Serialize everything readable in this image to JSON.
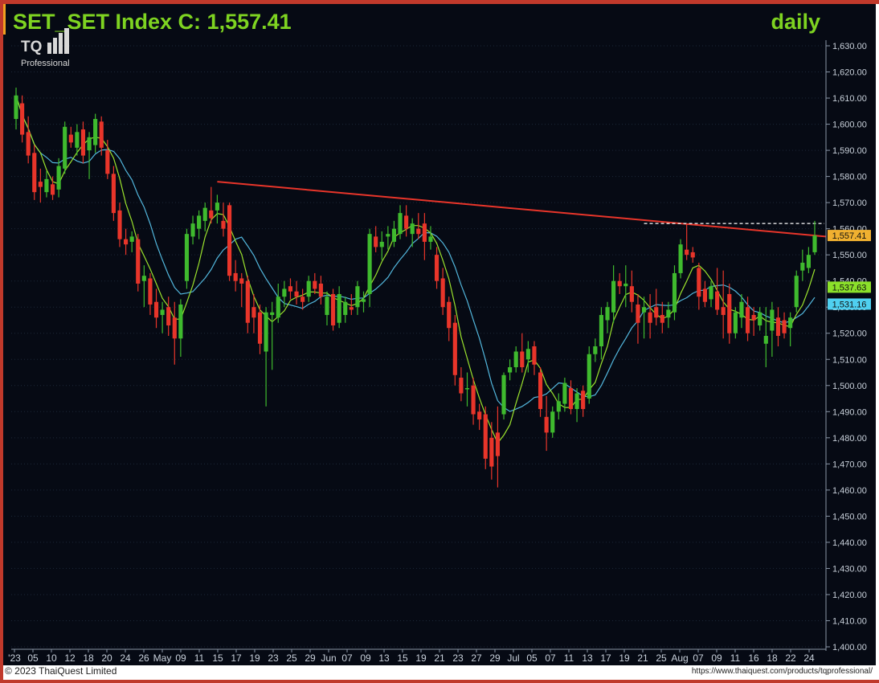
{
  "header": {
    "title": "SET_SET Index C: 1,557.41",
    "timeframe": "daily",
    "logo_text": "TQ",
    "logo_sub": "Professional"
  },
  "footer": {
    "copyright": "© 2023 ThaiQuest Limited",
    "url": "https://www.thaiquest.com/products/tqprofessional/"
  },
  "colors": {
    "background": "#060a14",
    "up": "#3fba2e",
    "down": "#e8352a",
    "ma_short": "#9be22d",
    "ma_long": "#52b6dc",
    "trendline": "#e8352a",
    "title": "#7ed321",
    "grid": "#1c2838"
  },
  "chart_data": {
    "type": "candlestick",
    "y_axis": {
      "min": 1400,
      "max": 1630,
      "ticks": [
        "1,630.00",
        "1,620.00",
        "1,610.00",
        "1,600.00",
        "1,590.00",
        "1,580.00",
        "1,570.00",
        "1,560.00",
        "1,550.00",
        "1,540.00",
        "1,530.00",
        "1,520.00",
        "1,510.00",
        "1,500.00",
        "1,490.00",
        "1,480.00",
        "1,470.00",
        "1,460.00",
        "1,450.00",
        "1,440.00",
        "1,430.00",
        "1,420.00",
        "1,410.00",
        "1,400.00"
      ]
    },
    "x_tick_labels": [
      "'23",
      "05",
      "10",
      "12",
      "18",
      "20",
      "24",
      "26",
      "May",
      "09",
      "11",
      "15",
      "17",
      "19",
      "23",
      "25",
      "29",
      "Jun",
      "07",
      "09",
      "13",
      "15",
      "19",
      "21",
      "23",
      "27",
      "29",
      "Jul",
      "05",
      "07",
      "11",
      "13",
      "17",
      "19",
      "21",
      "25",
      "Aug",
      "07",
      "09",
      "11",
      "16",
      "18",
      "22",
      "24"
    ],
    "price_labels": [
      {
        "text": "1,557.41",
        "value": 1557.41,
        "color": "#f0b030"
      },
      {
        "text": "1,537.63",
        "value": 1537.63,
        "color": "#8be02a"
      },
      {
        "text": "1,531.16",
        "value": 1531.16,
        "color": "#4fd0f0"
      }
    ],
    "resistance_level": 1562,
    "trendline": {
      "from": {
        "index": 33,
        "value": 1578
      },
      "to": {
        "index": 143,
        "value": 1557
      }
    },
    "candles": [
      {
        "o": 1602,
        "h": 1614,
        "l": 1598,
        "c": 1611
      },
      {
        "o": 1608,
        "h": 1611,
        "l": 1593,
        "c": 1596
      },
      {
        "o": 1597,
        "h": 1603,
        "l": 1585,
        "c": 1588
      },
      {
        "o": 1589,
        "h": 1592,
        "l": 1571,
        "c": 1574
      },
      {
        "o": 1578,
        "h": 1583,
        "l": 1570,
        "c": 1576
      },
      {
        "o": 1574,
        "h": 1582,
        "l": 1572,
        "c": 1579
      },
      {
        "o": 1577,
        "h": 1580,
        "l": 1571,
        "c": 1573
      },
      {
        "o": 1575,
        "h": 1587,
        "l": 1572,
        "c": 1584
      },
      {
        "o": 1583,
        "h": 1601,
        "l": 1581,
        "c": 1599
      },
      {
        "o": 1596,
        "h": 1599,
        "l": 1591,
        "c": 1593
      },
      {
        "o": 1591,
        "h": 1600,
        "l": 1588,
        "c": 1597
      },
      {
        "o": 1598,
        "h": 1601,
        "l": 1585,
        "c": 1588
      },
      {
        "o": 1590,
        "h": 1597,
        "l": 1579,
        "c": 1595
      },
      {
        "o": 1592,
        "h": 1604,
        "l": 1589,
        "c": 1602
      },
      {
        "o": 1601,
        "h": 1603,
        "l": 1588,
        "c": 1591
      },
      {
        "o": 1590,
        "h": 1594,
        "l": 1579,
        "c": 1581
      },
      {
        "o": 1581,
        "h": 1584,
        "l": 1563,
        "c": 1566
      },
      {
        "o": 1567,
        "h": 1570,
        "l": 1553,
        "c": 1556
      },
      {
        "o": 1556,
        "h": 1560,
        "l": 1550,
        "c": 1554
      },
      {
        "o": 1555,
        "h": 1559,
        "l": 1551,
        "c": 1557
      },
      {
        "o": 1556,
        "h": 1558,
        "l": 1536,
        "c": 1539
      },
      {
        "o": 1540,
        "h": 1546,
        "l": 1530,
        "c": 1542
      },
      {
        "o": 1541,
        "h": 1543,
        "l": 1527,
        "c": 1531
      },
      {
        "o": 1532,
        "h": 1537,
        "l": 1522,
        "c": 1526
      },
      {
        "o": 1527,
        "h": 1532,
        "l": 1520,
        "c": 1529
      },
      {
        "o": 1530,
        "h": 1534,
        "l": 1519,
        "c": 1523
      },
      {
        "o": 1526,
        "h": 1532,
        "l": 1508,
        "c": 1518
      },
      {
        "o": 1518,
        "h": 1533,
        "l": 1511,
        "c": 1531
      },
      {
        "o": 1540,
        "h": 1560,
        "l": 1537,
        "c": 1558
      },
      {
        "o": 1557,
        "h": 1565,
        "l": 1554,
        "c": 1562
      },
      {
        "o": 1560,
        "h": 1567,
        "l": 1556,
        "c": 1565
      },
      {
        "o": 1563,
        "h": 1570,
        "l": 1559,
        "c": 1568
      },
      {
        "o": 1567,
        "h": 1576,
        "l": 1562,
        "c": 1564
      },
      {
        "o": 1567,
        "h": 1573,
        "l": 1562,
        "c": 1570
      },
      {
        "o": 1563,
        "h": 1570,
        "l": 1557,
        "c": 1560
      },
      {
        "o": 1569,
        "h": 1570,
        "l": 1540,
        "c": 1542
      },
      {
        "o": 1543,
        "h": 1548,
        "l": 1536,
        "c": 1540
      },
      {
        "o": 1541,
        "h": 1543,
        "l": 1530,
        "c": 1539
      },
      {
        "o": 1540,
        "h": 1542,
        "l": 1520,
        "c": 1524
      },
      {
        "o": 1530,
        "h": 1535,
        "l": 1520,
        "c": 1526
      },
      {
        "o": 1528,
        "h": 1531,
        "l": 1512,
        "c": 1516
      },
      {
        "o": 1513,
        "h": 1530,
        "l": 1492,
        "c": 1528
      },
      {
        "o": 1527,
        "h": 1532,
        "l": 1506,
        "c": 1528
      },
      {
        "o": 1526,
        "h": 1539,
        "l": 1524,
        "c": 1534
      },
      {
        "o": 1534,
        "h": 1540,
        "l": 1530,
        "c": 1537
      },
      {
        "o": 1538,
        "h": 1541,
        "l": 1533,
        "c": 1536
      },
      {
        "o": 1536,
        "h": 1540,
        "l": 1531,
        "c": 1534
      },
      {
        "o": 1534,
        "h": 1537,
        "l": 1529,
        "c": 1532
      },
      {
        "o": 1534,
        "h": 1542,
        "l": 1532,
        "c": 1540
      },
      {
        "o": 1540,
        "h": 1543,
        "l": 1535,
        "c": 1537
      },
      {
        "o": 1539,
        "h": 1542,
        "l": 1531,
        "c": 1534
      },
      {
        "o": 1527,
        "h": 1536,
        "l": 1523,
        "c": 1534
      },
      {
        "o": 1535,
        "h": 1537,
        "l": 1521,
        "c": 1523
      },
      {
        "o": 1524,
        "h": 1538,
        "l": 1522,
        "c": 1535
      },
      {
        "o": 1527,
        "h": 1534,
        "l": 1524,
        "c": 1532
      },
      {
        "o": 1530,
        "h": 1535,
        "l": 1527,
        "c": 1529
      },
      {
        "o": 1530,
        "h": 1540,
        "l": 1527,
        "c": 1538
      },
      {
        "o": 1532,
        "h": 1536,
        "l": 1528,
        "c": 1533
      },
      {
        "o": 1535,
        "h": 1560,
        "l": 1530,
        "c": 1558
      },
      {
        "o": 1557,
        "h": 1561,
        "l": 1551,
        "c": 1553
      },
      {
        "o": 1553,
        "h": 1559,
        "l": 1548,
        "c": 1555
      },
      {
        "o": 1557,
        "h": 1561,
        "l": 1552,
        "c": 1558
      },
      {
        "o": 1555,
        "h": 1563,
        "l": 1553,
        "c": 1560
      },
      {
        "o": 1558,
        "h": 1569,
        "l": 1556,
        "c": 1566
      },
      {
        "o": 1565,
        "h": 1569,
        "l": 1557,
        "c": 1560
      },
      {
        "o": 1558,
        "h": 1564,
        "l": 1553,
        "c": 1562
      },
      {
        "o": 1560,
        "h": 1566,
        "l": 1556,
        "c": 1558
      },
      {
        "o": 1562,
        "h": 1566,
        "l": 1548,
        "c": 1555
      },
      {
        "o": 1555,
        "h": 1561,
        "l": 1552,
        "c": 1557
      },
      {
        "o": 1550,
        "h": 1553,
        "l": 1537,
        "c": 1540
      },
      {
        "o": 1541,
        "h": 1545,
        "l": 1527,
        "c": 1530
      },
      {
        "o": 1532,
        "h": 1534,
        "l": 1517,
        "c": 1522
      },
      {
        "o": 1524,
        "h": 1527,
        "l": 1500,
        "c": 1504
      },
      {
        "o": 1503,
        "h": 1507,
        "l": 1494,
        "c": 1497
      },
      {
        "o": 1499,
        "h": 1505,
        "l": 1492,
        "c": 1499
      },
      {
        "o": 1500,
        "h": 1503,
        "l": 1485,
        "c": 1489
      },
      {
        "o": 1490,
        "h": 1493,
        "l": 1483,
        "c": 1487
      },
      {
        "o": 1489,
        "h": 1492,
        "l": 1468,
        "c": 1472
      },
      {
        "o": 1480,
        "h": 1486,
        "l": 1464,
        "c": 1469
      },
      {
        "o": 1482,
        "h": 1492,
        "l": 1461,
        "c": 1473
      },
      {
        "o": 1489,
        "h": 1505,
        "l": 1487,
        "c": 1504
      },
      {
        "o": 1505,
        "h": 1510,
        "l": 1502,
        "c": 1507
      },
      {
        "o": 1507,
        "h": 1515,
        "l": 1505,
        "c": 1513
      },
      {
        "o": 1513,
        "h": 1520,
        "l": 1505,
        "c": 1507
      },
      {
        "o": 1510,
        "h": 1517,
        "l": 1505,
        "c": 1514
      },
      {
        "o": 1515,
        "h": 1517,
        "l": 1504,
        "c": 1508
      },
      {
        "o": 1505,
        "h": 1507,
        "l": 1488,
        "c": 1491
      },
      {
        "o": 1488,
        "h": 1496,
        "l": 1475,
        "c": 1482
      },
      {
        "o": 1482,
        "h": 1492,
        "l": 1480,
        "c": 1490
      },
      {
        "o": 1490,
        "h": 1497,
        "l": 1487,
        "c": 1494
      },
      {
        "o": 1493,
        "h": 1503,
        "l": 1490,
        "c": 1501
      },
      {
        "o": 1499,
        "h": 1502,
        "l": 1489,
        "c": 1491
      },
      {
        "o": 1491,
        "h": 1499,
        "l": 1486,
        "c": 1497
      },
      {
        "o": 1498,
        "h": 1500,
        "l": 1488,
        "c": 1491
      },
      {
        "o": 1495,
        "h": 1515,
        "l": 1493,
        "c": 1512
      },
      {
        "o": 1512,
        "h": 1518,
        "l": 1509,
        "c": 1515
      },
      {
        "o": 1515,
        "h": 1530,
        "l": 1510,
        "c": 1527
      },
      {
        "o": 1525,
        "h": 1532,
        "l": 1520,
        "c": 1530
      },
      {
        "o": 1528,
        "h": 1546,
        "l": 1524,
        "c": 1540
      },
      {
        "o": 1540,
        "h": 1543,
        "l": 1535,
        "c": 1538
      },
      {
        "o": 1538,
        "h": 1546,
        "l": 1530,
        "c": 1539
      },
      {
        "o": 1538,
        "h": 1544,
        "l": 1528,
        "c": 1532
      },
      {
        "o": 1531,
        "h": 1535,
        "l": 1516,
        "c": 1524
      },
      {
        "o": 1528,
        "h": 1534,
        "l": 1518,
        "c": 1530
      },
      {
        "o": 1528,
        "h": 1535,
        "l": 1518,
        "c": 1524
      },
      {
        "o": 1530,
        "h": 1537,
        "l": 1523,
        "c": 1526
      },
      {
        "o": 1527,
        "h": 1532,
        "l": 1520,
        "c": 1524
      },
      {
        "o": 1526,
        "h": 1532,
        "l": 1522,
        "c": 1529
      },
      {
        "o": 1528,
        "h": 1546,
        "l": 1525,
        "c": 1543
      },
      {
        "o": 1543,
        "h": 1556,
        "l": 1541,
        "c": 1554
      },
      {
        "o": 1552,
        "h": 1562,
        "l": 1548,
        "c": 1550
      },
      {
        "o": 1551,
        "h": 1553,
        "l": 1547,
        "c": 1549
      },
      {
        "o": 1545,
        "h": 1547,
        "l": 1529,
        "c": 1534
      },
      {
        "o": 1537,
        "h": 1540,
        "l": 1530,
        "c": 1532
      },
      {
        "o": 1533,
        "h": 1540,
        "l": 1530,
        "c": 1538
      },
      {
        "o": 1536,
        "h": 1545,
        "l": 1527,
        "c": 1529
      },
      {
        "o": 1530,
        "h": 1544,
        "l": 1518,
        "c": 1527
      },
      {
        "o": 1535,
        "h": 1539,
        "l": 1516,
        "c": 1520
      },
      {
        "o": 1520,
        "h": 1530,
        "l": 1518,
        "c": 1528
      },
      {
        "o": 1526,
        "h": 1535,
        "l": 1522,
        "c": 1532
      },
      {
        "o": 1530,
        "h": 1534,
        "l": 1517,
        "c": 1520
      },
      {
        "o": 1527,
        "h": 1530,
        "l": 1519,
        "c": 1525
      },
      {
        "o": 1523,
        "h": 1530,
        "l": 1521,
        "c": 1528
      },
      {
        "o": 1516,
        "h": 1530,
        "l": 1507,
        "c": 1519
      },
      {
        "o": 1521,
        "h": 1532,
        "l": 1511,
        "c": 1529
      },
      {
        "o": 1526,
        "h": 1530,
        "l": 1515,
        "c": 1519
      },
      {
        "o": 1525,
        "h": 1528,
        "l": 1518,
        "c": 1520
      },
      {
        "o": 1522,
        "h": 1528,
        "l": 1515,
        "c": 1526
      },
      {
        "o": 1530,
        "h": 1544,
        "l": 1528,
        "c": 1542
      },
      {
        "o": 1544,
        "h": 1552,
        "l": 1540,
        "c": 1547
      },
      {
        "o": 1545,
        "h": 1553,
        "l": 1543,
        "c": 1550
      },
      {
        "o": 1551,
        "h": 1563,
        "l": 1550,
        "c": 1557.41
      }
    ]
  }
}
